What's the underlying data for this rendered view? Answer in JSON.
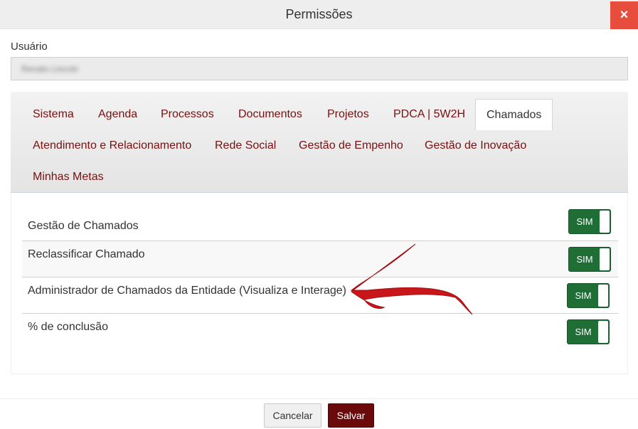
{
  "dialog": {
    "title": "Permissões",
    "close_label": "×"
  },
  "user": {
    "label": "Usuário",
    "value": "Renato Lincoln"
  },
  "tabs": [
    {
      "label": "Sistema"
    },
    {
      "label": "Agenda"
    },
    {
      "label": "Processos"
    },
    {
      "label": "Documentos"
    },
    {
      "label": "Projetos"
    },
    {
      "label": "PDCA | 5W2H"
    },
    {
      "label": "Chamados",
      "active": true
    },
    {
      "label": "Atendimento e Relacionamento"
    },
    {
      "label": "Rede Social"
    },
    {
      "label": "Gestão de Empenho"
    },
    {
      "label": "Gestão de Inovação"
    },
    {
      "label": "Minhas Metas"
    }
  ],
  "permissions": [
    {
      "label": "Gestão de Chamados",
      "toggle": "SIM"
    },
    {
      "label": "Reclassificar Chamado",
      "toggle": "SIM"
    },
    {
      "label": "Administrador de Chamados da Entidade (Visualiza e Interage)",
      "toggle": "SIM"
    },
    {
      "label": "% de conclusão",
      "toggle": "SIM"
    }
  ],
  "footer": {
    "cancel_label": "Cancelar",
    "save_label": "Salvar"
  },
  "colors": {
    "accent": "#7a0f0f",
    "close": "#e74c3c",
    "toggle_on": "#1e6e35",
    "annotation_arrow": "#c8161b"
  }
}
